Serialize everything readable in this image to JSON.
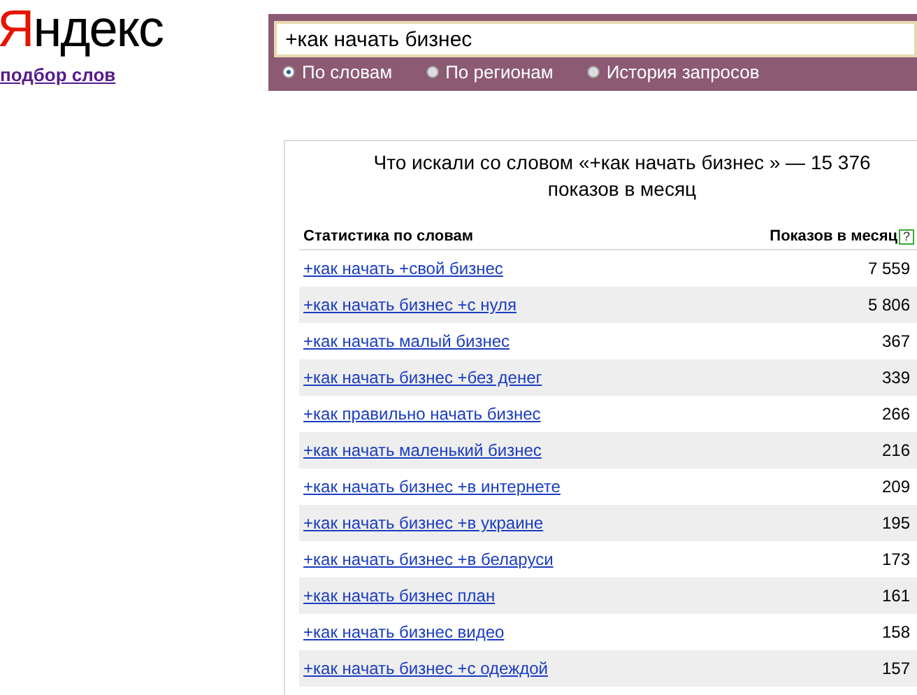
{
  "logo": {
    "first_letter": "Я",
    "rest": "ндекс"
  },
  "subtitle_link": "подбор слов",
  "search": {
    "value": "+как начать бизнес"
  },
  "modes": [
    {
      "label": "По словам",
      "selected": true
    },
    {
      "label": "По регионам",
      "selected": false
    },
    {
      "label": "История запросов",
      "selected": false
    }
  ],
  "results": {
    "title": "Что искали со словом «+как начать бизнес » — 15 376 показов в месяц",
    "columns": [
      "Статистика по словам",
      "Показов в месяц"
    ],
    "help": "?",
    "rows": [
      {
        "query": "+как начать +свой бизнес",
        "count": "7 559"
      },
      {
        "query": "+как начать бизнес +с нуля",
        "count": "5 806"
      },
      {
        "query": "+как начать малый бизнес",
        "count": "367"
      },
      {
        "query": "+как начать бизнес +без денег",
        "count": "339"
      },
      {
        "query": "+как правильно начать бизнес",
        "count": "266"
      },
      {
        "query": "+как начать маленький бизнес",
        "count": "216"
      },
      {
        "query": "+как начать бизнес +в интернете",
        "count": "209"
      },
      {
        "query": "+как начать бизнес +в украине",
        "count": "195"
      },
      {
        "query": "+как начать бизнес +в беларуси",
        "count": "173"
      },
      {
        "query": "+как начать бизнес план",
        "count": "161"
      },
      {
        "query": "+как начать бизнес видео",
        "count": "158"
      },
      {
        "query": "+как начать бизнес +с одеждой",
        "count": "157"
      }
    ]
  }
}
